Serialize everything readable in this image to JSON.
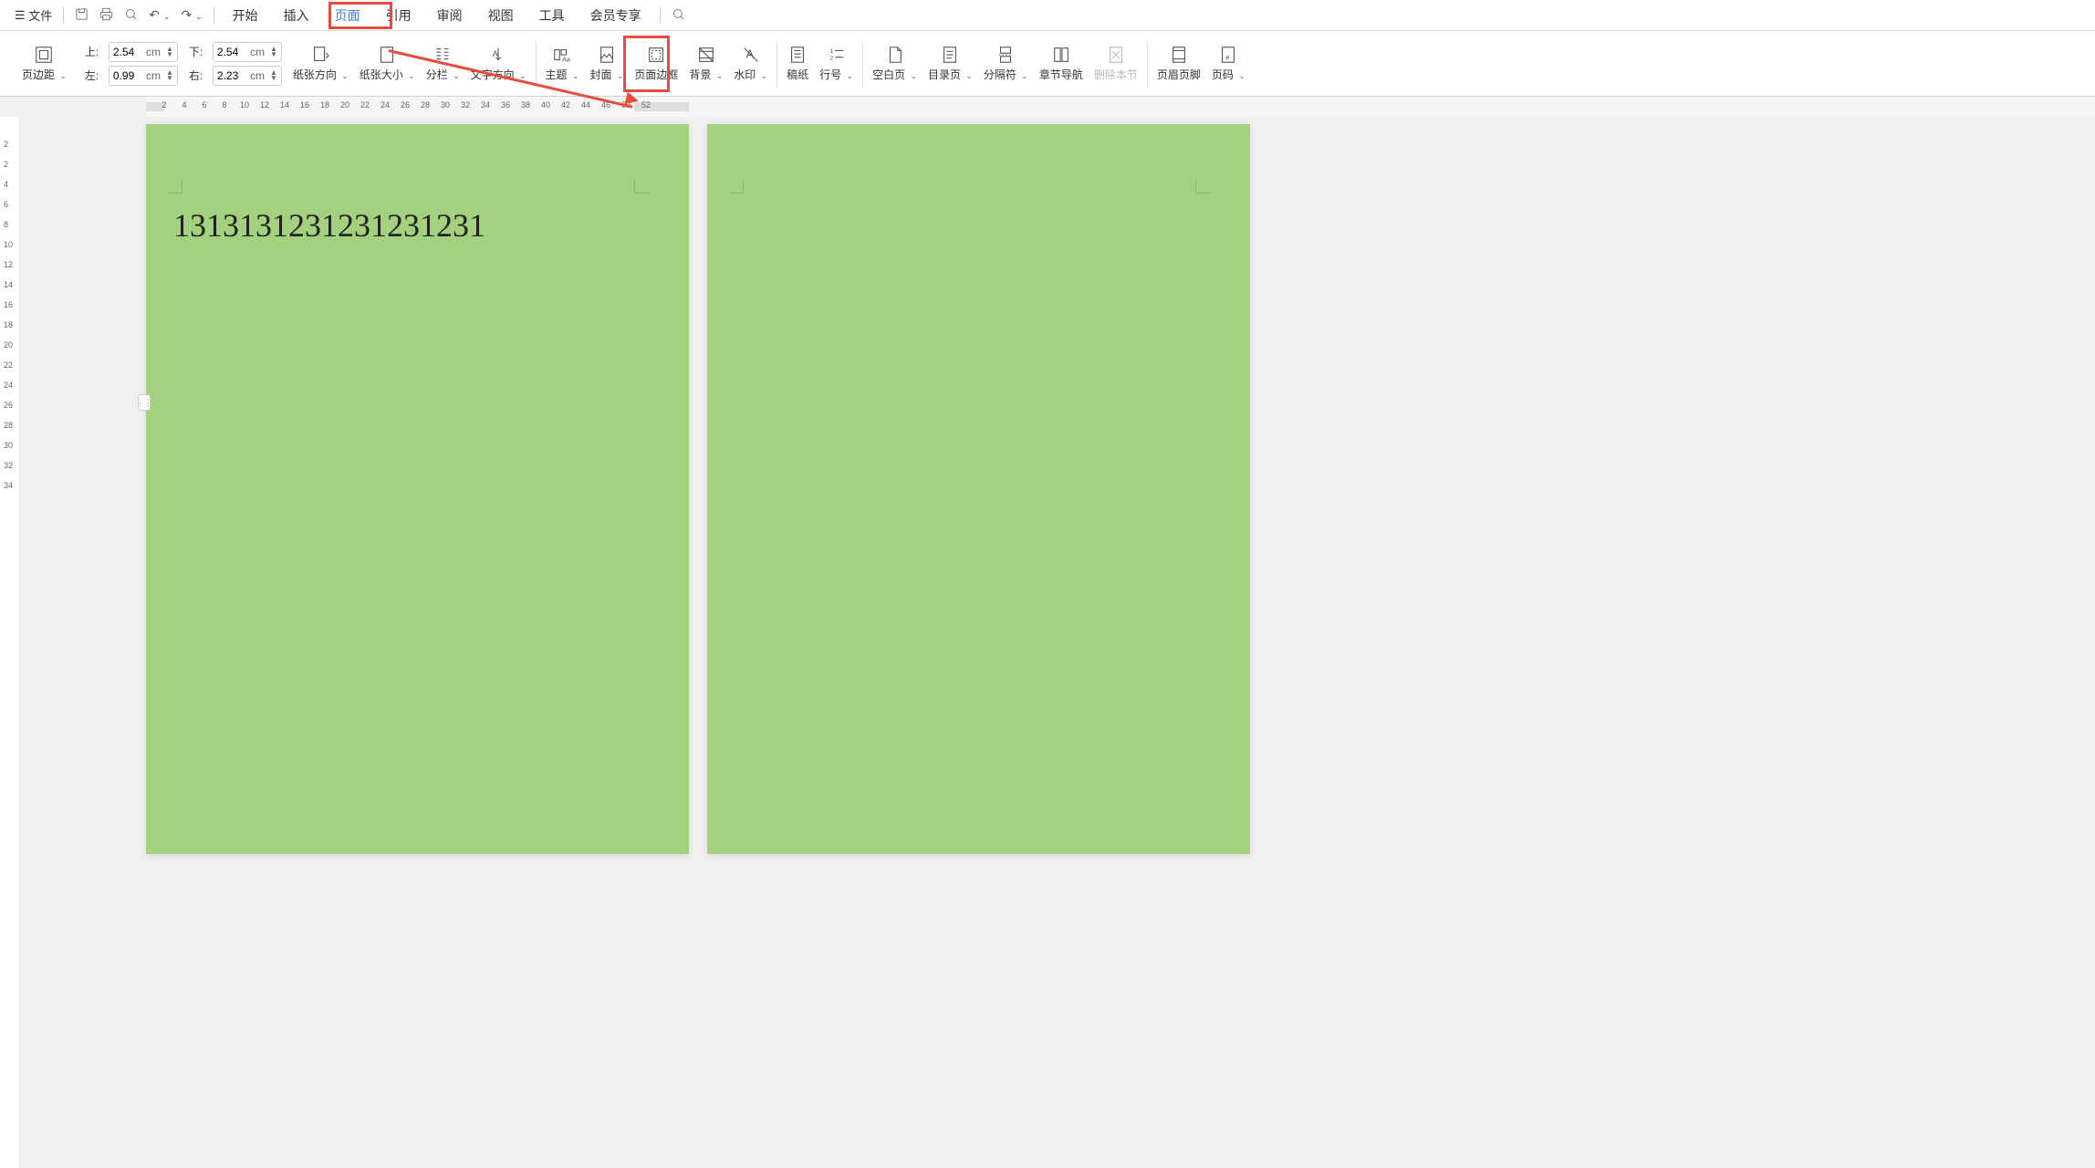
{
  "topbar": {
    "file_label": "文件"
  },
  "tabs": {
    "start": "开始",
    "insert": "插入",
    "page": "页面",
    "reference": "引用",
    "review": "审阅",
    "view": "视图",
    "tools": "工具",
    "member": "会员专享"
  },
  "ribbon": {
    "margins": {
      "button": "页边距",
      "top_label": "上:",
      "bottom_label": "下:",
      "left_label": "左:",
      "right_label": "右:",
      "top_val": "2.54",
      "bottom_val": "2.54",
      "left_val": "0.99",
      "right_val": "2.23",
      "unit": "cm"
    },
    "orientation": "纸张方向",
    "size": "纸张大小",
    "columns": "分栏",
    "text_direction": "文字方向",
    "theme": "主题",
    "cover": "封面",
    "border": "页面边框",
    "background": "背景",
    "watermark": "水印",
    "writing_paper": "稿纸",
    "line_number": "行号",
    "blank_page": "空白页",
    "toc_page": "目录页",
    "separator": "分隔符",
    "section_nav": "章节导航",
    "delete_section": "删除本节",
    "header_footer": "页眉页脚",
    "page_number": "页码"
  },
  "document": {
    "text": "1313131231231231231"
  },
  "hruler_ticks": [
    "2",
    "4",
    "6",
    "8",
    "10",
    "12",
    "14",
    "16",
    "18",
    "20",
    "22",
    "24",
    "26",
    "28",
    "30",
    "32",
    "34",
    "36",
    "38",
    "40",
    "42",
    "44",
    "46",
    "50",
    "52"
  ],
  "vruler_ticks": [
    "2",
    "2",
    "4",
    "6",
    "8",
    "10",
    "12",
    "14",
    "16",
    "18",
    "20",
    "22",
    "24",
    "26",
    "28",
    "30",
    "32",
    "34"
  ]
}
